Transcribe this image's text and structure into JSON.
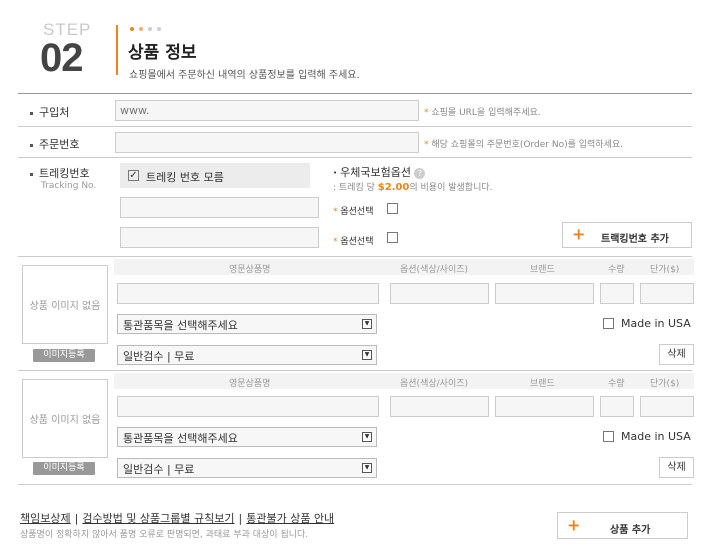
{
  "header": {
    "step_label": "STEP",
    "step_number": "02",
    "title": "상품 정보",
    "subtitle": "쇼핑몰에서 주문하신 내역의 상품정보를 입력해 주세요.",
    "dot_colors": [
      "#e8851c",
      "#f0b070",
      "#cccccc",
      "#cccccc"
    ]
  },
  "form": {
    "purchase_place": {
      "label": "구입처",
      "value": "www.",
      "hint_star": "*",
      "hint": "쇼핑몰 URL을 입력해주세요."
    },
    "order_number": {
      "label": "주문번호",
      "value": "",
      "hint_star": "*",
      "hint": "해당 쇼핑몰의 주문번호(Order No)를 입력하세요."
    },
    "tracking": {
      "label": "트레킹번호",
      "sublabel": "Tracking No.",
      "unknown_label": "트레킹 번호 모름",
      "unknown_checked": true,
      "insurance_title": "우체국보험옵션",
      "insurance_desc_pre": ": 트레킹 당 ",
      "insurance_price": "$2.00",
      "insurance_desc_post": "의 비용이 발생합니다.",
      "option_star": "*",
      "option_label": "옵션선택",
      "add_button": "트랙킹번호 추가"
    }
  },
  "products": {
    "columns": [
      "영문상품명",
      "옵션(색상/사이즈)",
      "브랜드",
      "수량",
      "단가($)"
    ],
    "items": [
      {
        "image_placeholder": "상품 이미지 없음",
        "image_button": "이미지등록",
        "customs_select": "통관품목을 선택해주세요",
        "inspection_select": "일반검수 | 무료",
        "made_in_usa": "Made in USA",
        "delete_button": "삭제"
      },
      {
        "image_placeholder": "상품 이미지 없음",
        "image_button": "이미지등록",
        "customs_select": "통관품목을 선택해주세요",
        "inspection_select": "일반검수 | 무료",
        "made_in_usa": "Made in USA",
        "delete_button": "삭제"
      }
    ]
  },
  "footer": {
    "links": [
      "책임보상제",
      "검수방법 및 상품그룹별 규칙보기",
      "통관불가 상품 안내"
    ],
    "separator": "|",
    "note": "상품명이 정확하지 않아서 품명 오류로 판명되면, 과태료 부과 대상이 됩니다.",
    "add_product_button": "상품 추가"
  },
  "colors": {
    "accent": "#e8851c",
    "muted": "#999999"
  }
}
